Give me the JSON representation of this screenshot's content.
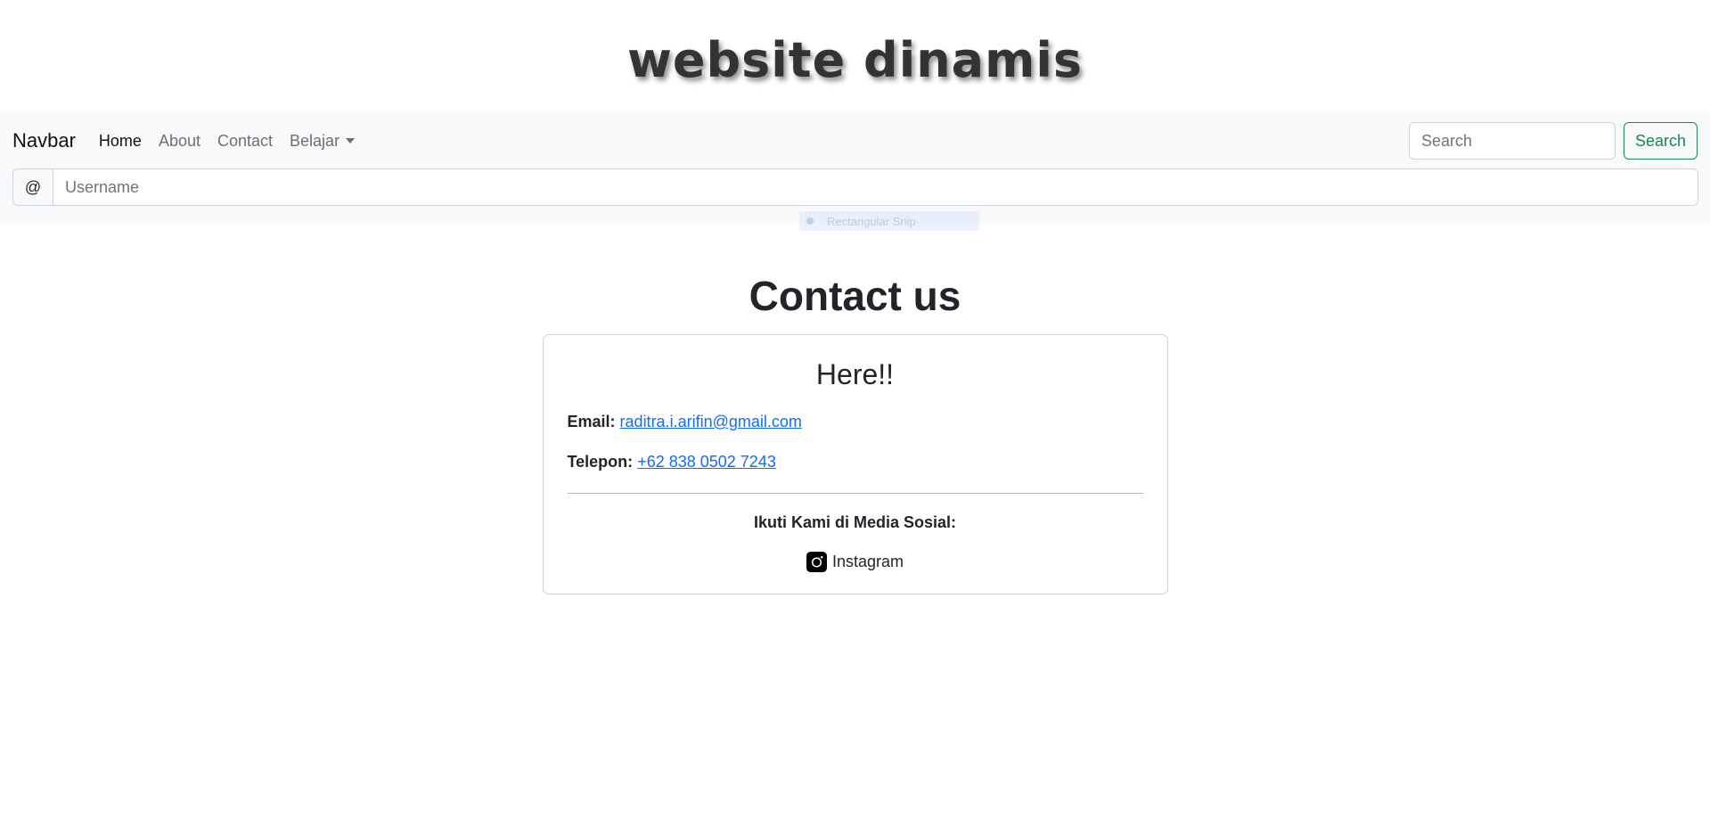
{
  "header": {
    "site_title": "website dinamis"
  },
  "navbar": {
    "brand": "Navbar",
    "links": [
      {
        "label": "Home",
        "active": true
      },
      {
        "label": "About",
        "active": false
      },
      {
        "label": "Contact",
        "active": false
      },
      {
        "label": "Belajar",
        "active": false,
        "dropdown": true
      }
    ],
    "search": {
      "placeholder": "Search",
      "button_label": "Search"
    }
  },
  "username_group": {
    "prefix": "@",
    "placeholder": "Username"
  },
  "overlay": {
    "label": "Rectangular Snip"
  },
  "main": {
    "heading": "Contact us",
    "card": {
      "title": "Here!!",
      "email_label": "Email:",
      "email_value": "raditra.i.arifin@gmail.com",
      "phone_label": "Telepon:",
      "phone_value": "+62 838 0502 7243",
      "social_heading": "Ikuti Kami di Media Sosial:",
      "social_links": [
        {
          "label": "Instagram",
          "icon": "instagram-icon"
        }
      ]
    }
  },
  "colors": {
    "link": "#0d6efd",
    "success": "#198754",
    "navbar_bg": "#f8f9fa"
  }
}
